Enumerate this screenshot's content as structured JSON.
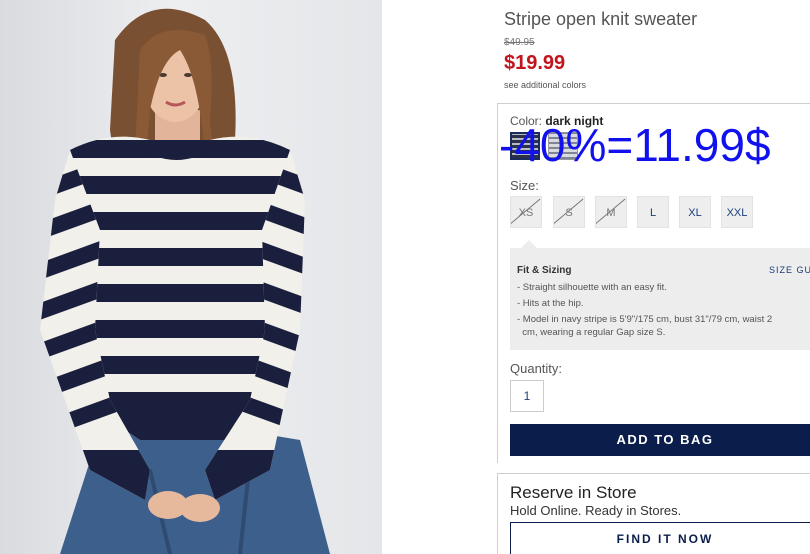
{
  "product": {
    "title": "Stripe open knit sweater",
    "old_price": "$49.95",
    "sale_price": "$19.99",
    "see_colors": "see additional colors"
  },
  "color": {
    "label": "Color:",
    "selected": "dark night"
  },
  "annotation": "-40%=11.99$",
  "size": {
    "label": "Size:",
    "options": [
      {
        "label": "XS",
        "available": false
      },
      {
        "label": "S",
        "available": false
      },
      {
        "label": "M",
        "available": false
      },
      {
        "label": "L",
        "available": true
      },
      {
        "label": "XL",
        "available": true
      },
      {
        "label": "XXL",
        "available": true
      }
    ]
  },
  "fit": {
    "title": "Fit & Sizing",
    "size_guide": "SIZE GU",
    "items": [
      "- Straight silhouette with an easy fit.",
      "- Hits at the hip.",
      "- Model in navy stripe is 5'9\"/175 cm, bust 31\"/79 cm, waist 2",
      "  cm, wearing a regular Gap size S."
    ]
  },
  "quantity": {
    "label": "Quantity:",
    "value": "1"
  },
  "add_to_bag": "ADD TO BAG",
  "store": {
    "title": "Reserve in Store",
    "subtitle": "Hold Online. Ready in Stores.",
    "button": "FIND IT NOW"
  },
  "colors": {
    "sale_red": "#c2141b",
    "navy": "#0b1d4a",
    "annotation_blue": "#1111ee"
  }
}
